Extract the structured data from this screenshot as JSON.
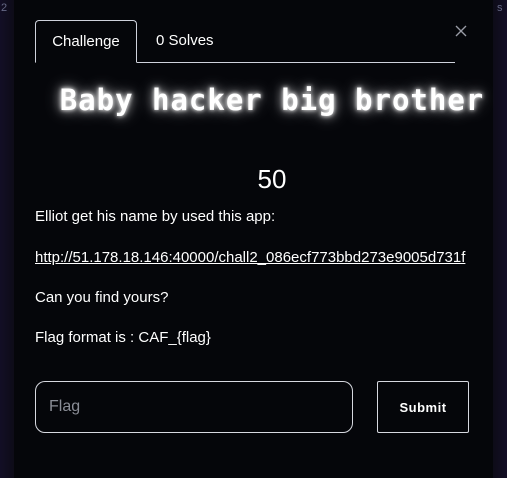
{
  "modal": {
    "tabs": [
      {
        "label": "Challenge",
        "active": true
      },
      {
        "label": "0 Solves",
        "active": false
      }
    ],
    "title": "Baby hacker big brother",
    "value": "50",
    "description": {
      "line1": "Elliot get his name by used this app:",
      "link": "http://51.178.18.146:40000/chall2_086ecf773bbd273e9005d731f",
      "line3": "Can you find yours?",
      "line4": "Flag format is : CAF_{flag}"
    },
    "flag_input": {
      "placeholder": "Flag",
      "value": ""
    },
    "submit_label": "Submit",
    "close_icon": "close-icon"
  },
  "colors": {
    "background": "#05060a",
    "border": "#cfd2dc",
    "text": "#ffffff",
    "placeholder": "#8a8d96"
  }
}
